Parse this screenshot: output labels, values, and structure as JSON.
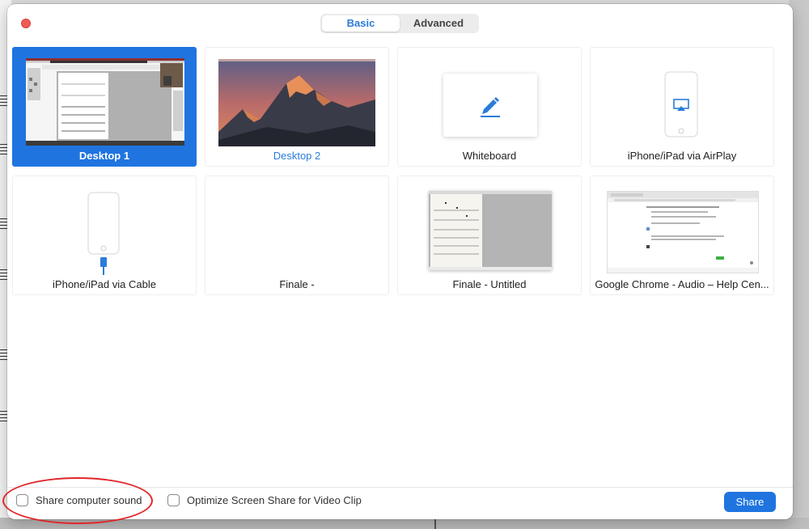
{
  "dialog": {
    "tabs": [
      {
        "label": "Basic",
        "active": true
      },
      {
        "label": "Advanced",
        "active": false
      }
    ]
  },
  "tiles": [
    {
      "label": "Desktop 1",
      "selected": true,
      "thumb": "desktop-screenshot"
    },
    {
      "label": "Desktop 2",
      "selected": false,
      "thumb": "mountain-wallpaper"
    },
    {
      "label": "Whiteboard",
      "selected": false,
      "thumb": "pencil-icon"
    },
    {
      "label": "iPhone/iPad via AirPlay",
      "selected": false,
      "thumb": "airplay-icon"
    },
    {
      "label": "iPhone/iPad via Cable",
      "selected": false,
      "thumb": "cable-phone-icon"
    },
    {
      "label": "Finale -",
      "selected": false,
      "thumb": "blank"
    },
    {
      "label": "Finale - Untitled",
      "selected": false,
      "thumb": "score-window"
    },
    {
      "label": "Google Chrome - Audio – Help Cen...",
      "selected": false,
      "thumb": "browser-window"
    }
  ],
  "footer": {
    "share_sound_label": "Share computer sound",
    "optimize_label": "Optimize Screen Share for Video Clip",
    "share_button": "Share"
  },
  "colors": {
    "accent": "#1f74e0",
    "close": "#ee5b56",
    "annotation": "#e0262b"
  }
}
